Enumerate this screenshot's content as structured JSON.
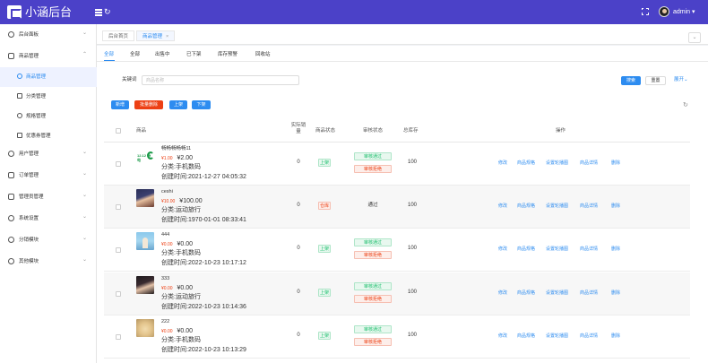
{
  "header": {
    "logo_text": "小涵后台",
    "refresh_icon": "↻",
    "user_name": "admin",
    "user_caret": "▾"
  },
  "sidebar": {
    "items": [
      {
        "label": "后台面板"
      },
      {
        "label": "商品管理",
        "sub": [
          {
            "label": "商品管理"
          },
          {
            "label": "分类管理"
          },
          {
            "label": "规格管理"
          },
          {
            "label": "优惠券管理"
          }
        ]
      },
      {
        "label": "用户管理"
      },
      {
        "label": "订单管理"
      },
      {
        "label": "管理员管理"
      },
      {
        "label": "系统设置"
      },
      {
        "label": "分销模块"
      },
      {
        "label": "其他模块"
      }
    ]
  },
  "tabs": {
    "home": "后台首页",
    "current": "商品管理",
    "close": "×",
    "menu": "⌄"
  },
  "status_tabs": [
    "全部",
    "全部",
    "出售中",
    "已下架",
    "库存预警",
    "回收站"
  ],
  "search": {
    "label": "关键词",
    "placeholder": "商品名称",
    "search_btn": "搜索",
    "reset_btn": "重置",
    "expand": "展开⌄"
  },
  "actions": {
    "add": "新增",
    "batch_delete": "批量删除",
    "on_shelf": "上架",
    "off_shelf": "下架",
    "refresh_icon": "↻"
  },
  "table": {
    "headers": {
      "product": "商品",
      "sales_line1": "实际销",
      "sales_line2": "量",
      "status": "商品状态",
      "audit": "审核状态",
      "stock": "总库存",
      "ops": "操作"
    },
    "ops": [
      "修改",
      "商品规格",
      "设置轮播图",
      "商品详情",
      "删除"
    ],
    "audit_pass": "审核通过",
    "audit_reject": "审核拒绝",
    "rows": [
      {
        "name": "畅畅畅畅畅11",
        "price": "¥1.00",
        "orig": "¥2.00",
        "category": "分类:手机数码",
        "created": "创建时间:2021-12-27 04:05:32",
        "sales": "0",
        "status": "上架",
        "status_type": "on",
        "audit": "pending",
        "stock": "100",
        "thumb": "logo",
        "thumb_text": "12.12 畅电"
      },
      {
        "name": "ceshi",
        "price": "¥10.00",
        "orig": "¥100.00",
        "category": "分类:运动旅行",
        "created": "创建时间:1970-01-01 08:33:41",
        "sales": "0",
        "status": "仓库",
        "status_type": "off",
        "audit": "done",
        "audit_text": "通过",
        "stock": "100",
        "thumb": "girl"
      },
      {
        "name": "444",
        "price": "¥0.00",
        "orig": "¥0.00",
        "category": "分类:手机数码",
        "created": "创建时间:2022-10-23 10:17:12",
        "sales": "0",
        "status": "上架",
        "status_type": "on",
        "audit": "pending",
        "stock": "100",
        "thumb": "blue"
      },
      {
        "name": "333",
        "price": "¥0.00",
        "orig": "¥0.00",
        "category": "分类:运动旅行",
        "created": "创建时间:2022-10-23 10:14:36",
        "sales": "0",
        "status": "上架",
        "status_type": "on",
        "audit": "pending",
        "stock": "100",
        "thumb": "dark"
      },
      {
        "name": "222",
        "price": "¥0.00",
        "orig": "¥0.00",
        "category": "分类:手机数码",
        "created": "创建时间:2022-10-23 10:13:29",
        "sales": "0",
        "status": "上架",
        "status_type": "on",
        "audit": "pending",
        "stock": "100",
        "thumb": "dog"
      }
    ]
  },
  "colors": {
    "header_bg": "#4b41c8",
    "primary": "#2d8cf0",
    "danger": "#ed4014",
    "success": "#19be6b"
  }
}
